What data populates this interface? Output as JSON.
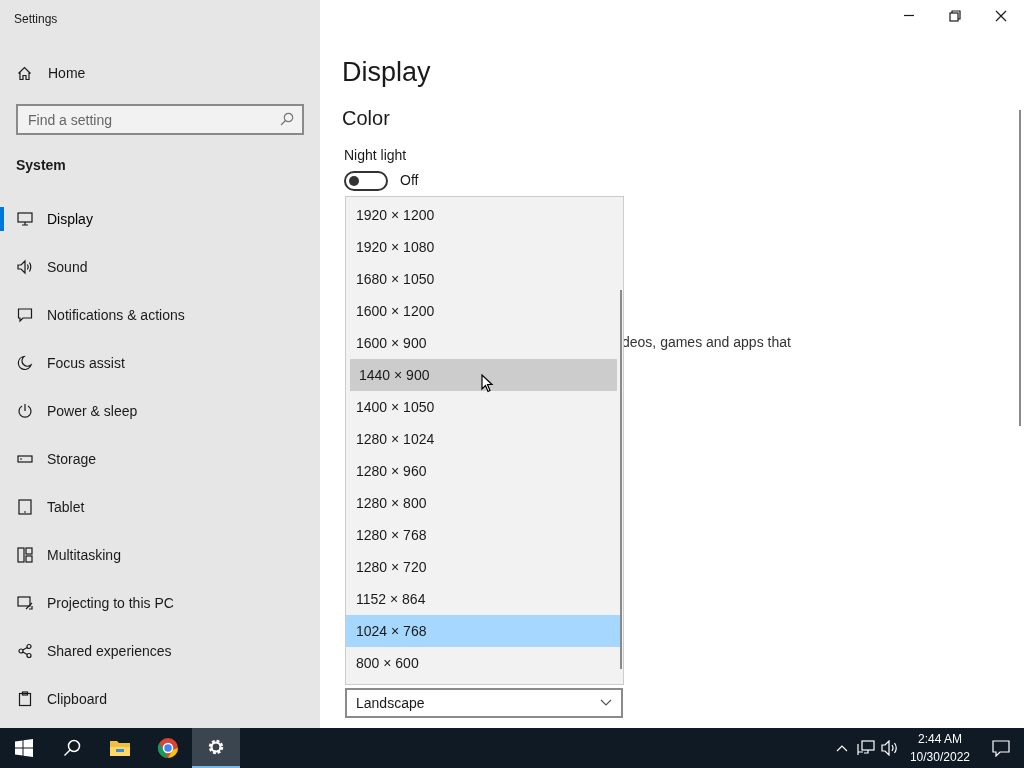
{
  "window": {
    "title": "Settings"
  },
  "sidebar": {
    "home": "Home",
    "search": {
      "placeholder": "Find a setting"
    },
    "section": "System",
    "items": [
      {
        "label": "Display",
        "selected": true
      },
      {
        "label": "Sound",
        "selected": false
      },
      {
        "label": "Notifications & actions",
        "selected": false
      },
      {
        "label": "Focus assist",
        "selected": false
      },
      {
        "label": "Power & sleep",
        "selected": false
      },
      {
        "label": "Storage",
        "selected": false
      },
      {
        "label": "Tablet",
        "selected": false
      },
      {
        "label": "Multitasking",
        "selected": false
      },
      {
        "label": "Projecting to this PC",
        "selected": false
      },
      {
        "label": "Shared experiences",
        "selected": false
      },
      {
        "label": "Clipboard",
        "selected": false
      }
    ]
  },
  "main": {
    "heading": "Display",
    "section": "Color",
    "night_light": {
      "label": "Night light",
      "on": false,
      "state": "Off"
    },
    "partial_text": "deos, games and apps that",
    "orientation": {
      "value": "Landscape"
    },
    "resolution_list": [
      {
        "label": "1920 × 1200",
        "selected": false,
        "hovered": false
      },
      {
        "label": "1920 × 1080",
        "selected": false,
        "hovered": false
      },
      {
        "label": "1680 × 1050",
        "selected": false,
        "hovered": false
      },
      {
        "label": "1600 × 1200",
        "selected": false,
        "hovered": false
      },
      {
        "label": "1600 × 900",
        "selected": false,
        "hovered": false
      },
      {
        "label": "1440 × 900",
        "selected": false,
        "hovered": true
      },
      {
        "label": "1400 × 1050",
        "selected": false,
        "hovered": false
      },
      {
        "label": "1280 × 1024",
        "selected": false,
        "hovered": false
      },
      {
        "label": "1280 × 960",
        "selected": false,
        "hovered": false
      },
      {
        "label": "1280 × 800",
        "selected": false,
        "hovered": false
      },
      {
        "label": "1280 × 768",
        "selected": false,
        "hovered": false
      },
      {
        "label": "1280 × 720",
        "selected": false,
        "hovered": false
      },
      {
        "label": "1152 × 864",
        "selected": false,
        "hovered": false
      },
      {
        "label": "1024 × 768",
        "selected": true,
        "hovered": false
      },
      {
        "label": "800 × 600",
        "selected": false,
        "hovered": false
      }
    ]
  },
  "taskbar": {
    "apps": [
      {
        "active": false
      },
      {
        "active": false
      },
      {
        "active": false
      },
      {
        "active": false
      },
      {
        "active": true
      }
    ],
    "time": "2:44 AM",
    "date": "10/30/2022"
  }
}
